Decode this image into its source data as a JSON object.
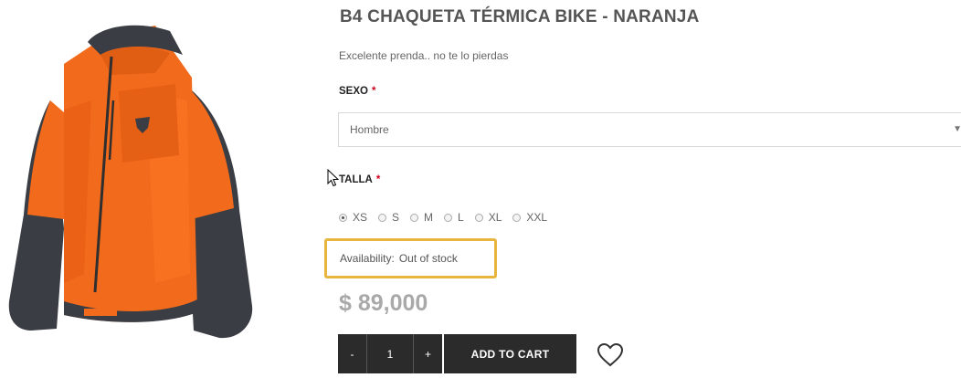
{
  "product": {
    "title": "B4 CHAQUETA TÉRMICA BIKE - NARANJA",
    "short_description": "Excelente prenda.. no te lo pierdas",
    "price": "$ 89,000",
    "availability_label": "Availability:",
    "availability_value": "Out of stock"
  },
  "options": {
    "sexo": {
      "label": "SEXO",
      "required_mark": "*",
      "selected": "Hombre"
    },
    "talla": {
      "label": "TALLA",
      "required_mark": "*",
      "sizes": [
        "XS",
        "S",
        "M",
        "L",
        "XL",
        "XXL"
      ],
      "selected": "XS"
    }
  },
  "cart": {
    "minus_label": "-",
    "quantity": "1",
    "plus_label": "+",
    "add_to_cart_label": "ADD TO CART"
  },
  "icons": {
    "wishlist": "heart-icon",
    "select_arrow": "caret-down-icon"
  },
  "colors": {
    "jacket_orange": "#f26a1b",
    "jacket_dark": "#3a3d44",
    "button_dark": "#2b2b2b",
    "highlight_border": "#e8b63e",
    "required_red": "#d0021b",
    "price_gray": "#a9a9a9"
  }
}
